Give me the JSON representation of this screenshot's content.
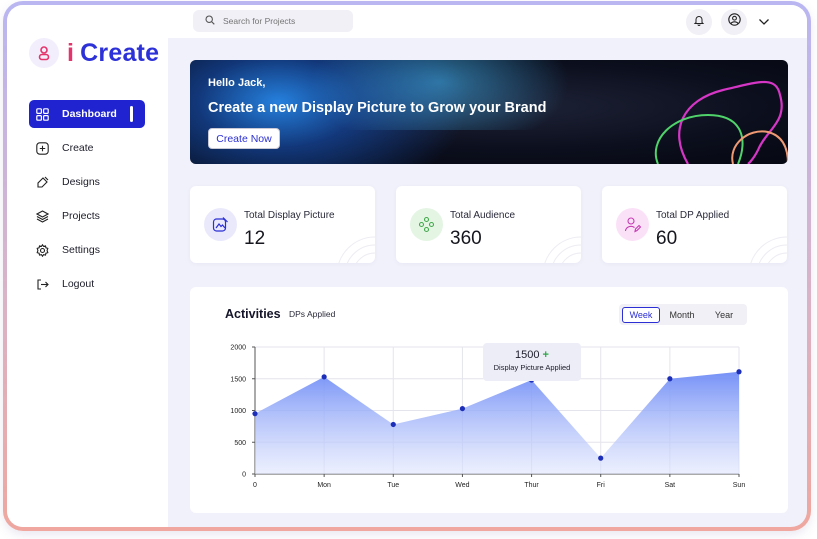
{
  "brand": {
    "prefix": "i",
    "name": "Create"
  },
  "sidebar": {
    "items": [
      {
        "label": "Dashboard",
        "icon": "grid-icon",
        "active": true
      },
      {
        "label": "Create",
        "icon": "plus-square-icon"
      },
      {
        "label": "Designs",
        "icon": "brush-icon"
      },
      {
        "label": "Projects",
        "icon": "layers-icon"
      },
      {
        "label": "Settings",
        "icon": "gear-icon"
      },
      {
        "label": "Logout",
        "icon": "logout-icon"
      }
    ]
  },
  "search": {
    "placeholder": "Search for Projects"
  },
  "banner": {
    "greeting": "Hello Jack,",
    "title": "Create a new Display Picture to Grow your Brand",
    "button": "Create Now"
  },
  "stats": [
    {
      "label": "Total Display Picture",
      "value": "12",
      "color": "#e9e9fb"
    },
    {
      "label": "Total Audience",
      "value": "360",
      "color": "#e4f5e4"
    },
    {
      "label": "Total DP Applied",
      "value": "60",
      "color": "#fbe1f7"
    }
  ],
  "activities": {
    "title": "Activities",
    "subtitle": "DPs Applied",
    "ranges": [
      "Week",
      "Month",
      "Year"
    ],
    "selected_range": "Week",
    "tooltip": {
      "value": "1500",
      "delta_symbol": "+",
      "label": "Display Picture Applied"
    }
  },
  "chart_data": {
    "type": "area",
    "categories": [
      "0",
      "Mon",
      "Tue",
      "Wed",
      "Thur",
      "Fri",
      "Sat",
      "Sun"
    ],
    "values": [
      950,
      1530,
      780,
      1030,
      1480,
      250,
      1500,
      1610
    ],
    "ylim": [
      0,
      2000
    ],
    "yticks": [
      0,
      500,
      1000,
      1500,
      2000
    ],
    "grid": true,
    "fill_color": "#6f8cf6",
    "point_color": "#1d2fb8"
  },
  "colors": {
    "accent": "#1f24d0",
    "brand_i": "#e6336b"
  }
}
